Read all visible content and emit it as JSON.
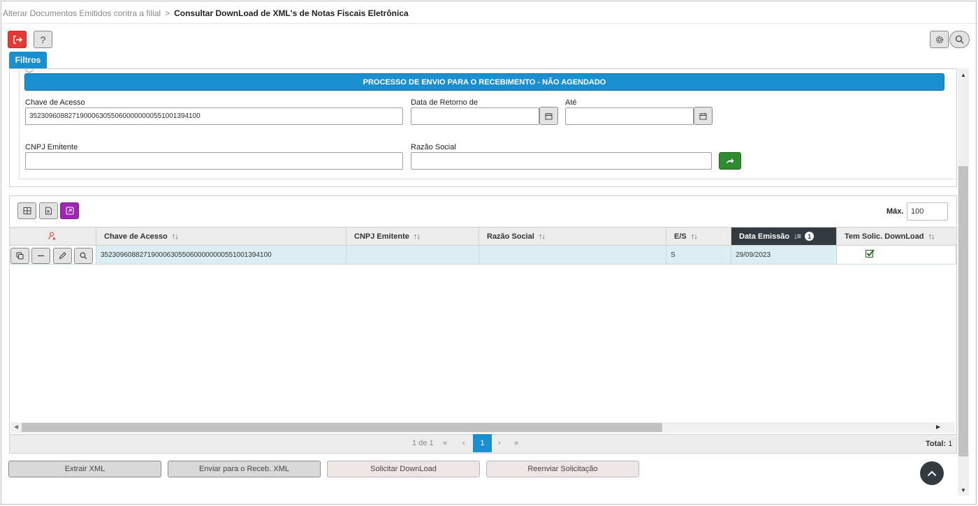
{
  "breadcrumb": {
    "parent": "Alterar Documentos Emitidos contra a filial",
    "separator": ">",
    "current": "Consultar DownLoad de XML's de Notas Fiscais Eletrônica"
  },
  "toolbar": {
    "help_label": "?"
  },
  "filters": {
    "tab_label": "Filtros",
    "process_label": "PROCESSO DE ENVIO PARA O RECEBIMENTO - NÃO AGENDADO",
    "chave_label": "Chave de Acesso",
    "chave_value": "35230960882719000630550600000000551001394100",
    "data_retorno_label": "Data de Retorno de",
    "data_retorno_value": "",
    "ate_label": "Até",
    "ate_value": "",
    "cnpj_label": "CNPJ Emitente",
    "cnpj_value": "",
    "razao_label": "Razão Social",
    "razao_value": ""
  },
  "grid": {
    "max_label": "Máx.",
    "max_value": "100",
    "columns": [
      {
        "label": "Chave de Acesso",
        "sort": "↑↓"
      },
      {
        "label": "CNPJ Emitente",
        "sort": "↑↓"
      },
      {
        "label": "Razão Social",
        "sort": "↑↓"
      },
      {
        "label": "E/S",
        "sort": "↑↓"
      },
      {
        "label": "Data Emissão",
        "sort": "↓≡",
        "badge": "1"
      },
      {
        "label": "Tem Solic. DownLoad",
        "sort": "↑↓"
      }
    ],
    "rows": [
      {
        "chave": "35230960882719000630550600000000551001394100",
        "cnpj": "",
        "razao": "",
        "es": "S",
        "data": "29/09/2023",
        "tem_solic": true
      }
    ],
    "pager": {
      "page_info": "1 de 1",
      "first": "«",
      "prev": "‹",
      "current": "1",
      "next": "›",
      "last": "»",
      "total_label": "Total:",
      "total_value": "1"
    }
  },
  "actions": {
    "extrair": "Extrair XML",
    "enviar": "Enviar para o Receb. XML",
    "solicitar": "Solicitar DownLoad",
    "reenviar": "Reenviar Solicitação"
  },
  "colors": {
    "accent": "#1a8fd0",
    "exit": "#e53935",
    "go": "#2e8b2e",
    "header_active": "#333a40",
    "row_selected": "#dbeef3"
  }
}
